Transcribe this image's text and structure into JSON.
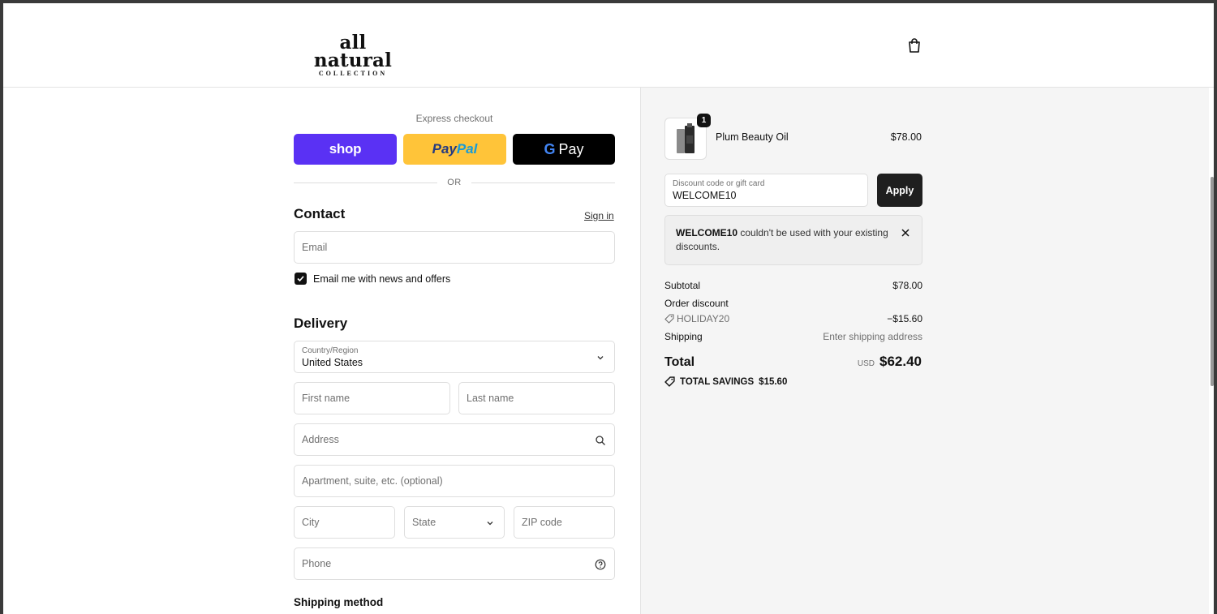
{
  "brand": {
    "name": "all natural",
    "sub": "COLLECTION"
  },
  "express": {
    "label": "Express checkout",
    "shop_label": "shop",
    "paypal_part1": "Pay",
    "paypal_part2": "Pal",
    "gpay_g": "G",
    "gpay_label": "Pay",
    "or_label": "OR"
  },
  "contact": {
    "title": "Contact",
    "sign_in": "Sign in",
    "email_placeholder": "Email",
    "newsletter_label": "Email me with news and offers",
    "newsletter_checked": true
  },
  "delivery": {
    "title": "Delivery",
    "country_label": "Country/Region",
    "country_value": "United States",
    "first_name": "First name",
    "last_name": "Last name",
    "address": "Address",
    "apartment": "Apartment, suite, etc. (optional)",
    "city": "City",
    "state": "State",
    "zip": "ZIP code",
    "phone": "Phone"
  },
  "shipping_method": {
    "title": "Shipping method"
  },
  "summary": {
    "item": {
      "name": "Plum Beauty Oil",
      "price": "$78.00",
      "quantity": "1"
    },
    "discount_label": "Discount code or gift card",
    "discount_value": "WELCOME10",
    "apply_label": "Apply",
    "notice_code": "WELCOME10",
    "notice_text": " couldn't be used with your existing discounts.",
    "subtotal_label": "Subtotal",
    "subtotal_value": "$78.00",
    "order_discount_label": "Order discount",
    "discount_code_applied": "HOLIDAY20",
    "discount_amount": "−$15.60",
    "shipping_label": "Shipping",
    "shipping_value": "Enter shipping address",
    "total_label": "Total",
    "currency": "USD",
    "total_value": "$62.40",
    "savings_label": "TOTAL SAVINGS",
    "savings_value": "$15.60"
  },
  "colors": {
    "shop": "#5a31f4",
    "paypal": "#ffc439",
    "gpay": "#000000",
    "apply": "#1f1f1f"
  }
}
